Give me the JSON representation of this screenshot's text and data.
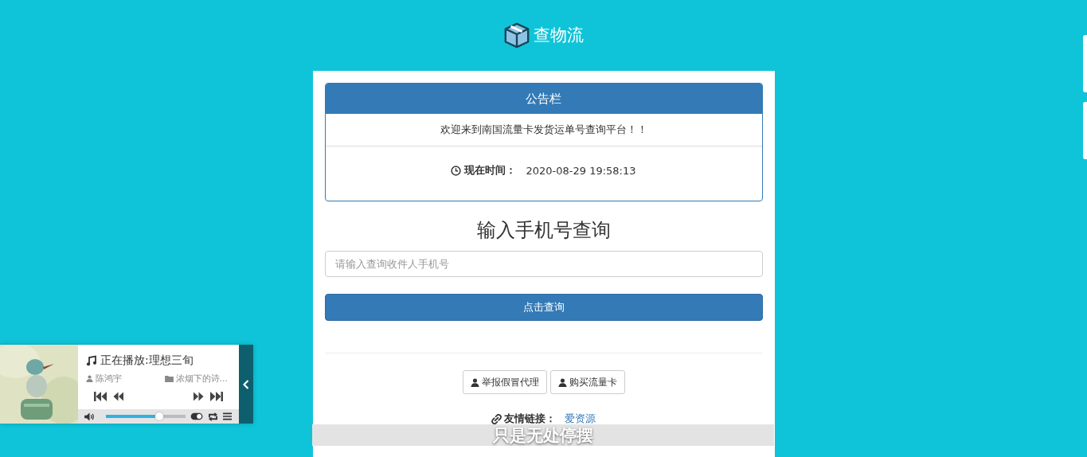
{
  "logo": {
    "text": "查物流"
  },
  "notice": {
    "title": "公告栏",
    "message": "欢迎来到南国流量卡发货运单号查询平台！！",
    "time_label": "现在时间：",
    "time_value": "2020-08-29 19:58:13"
  },
  "query": {
    "heading": "输入手机号查询",
    "placeholder": "请输入查询收件人手机号",
    "button": "点击查询"
  },
  "actions": [
    "举报假冒代理",
    "购买流量卡"
  ],
  "links": {
    "label": "友情链接：",
    "items": [
      "爱资源"
    ]
  },
  "player": {
    "now_playing": "正在播放:理想三旬",
    "artist": "陈鸿宇",
    "album": "浓烟下的诗...",
    "volume": {
      "level": 0.67
    }
  },
  "lyric": "只是无处停摆"
}
